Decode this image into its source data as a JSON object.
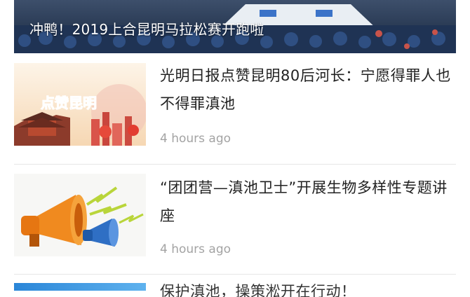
{
  "hero": {
    "title": "冲鸭！2019上合昆明马拉松赛开跑啦"
  },
  "articles": [
    {
      "title": "光明日报点赞昆明80后河长：宁愿得罪人也不得罪滇池",
      "time": "4 hours ago",
      "thumb_text": "点赞昆明"
    },
    {
      "title": "“团团营—滇池卫士”开展生物多样性专题讲座",
      "time": "4 hours ago",
      "thumb_text": ""
    },
    {
      "title": "保护滇池，操策淞开在行动！",
      "time": "",
      "thumb_text": ""
    }
  ],
  "colors": {
    "text": "#222222",
    "time": "#a3a3a3",
    "divider": "#e6e6e6"
  }
}
